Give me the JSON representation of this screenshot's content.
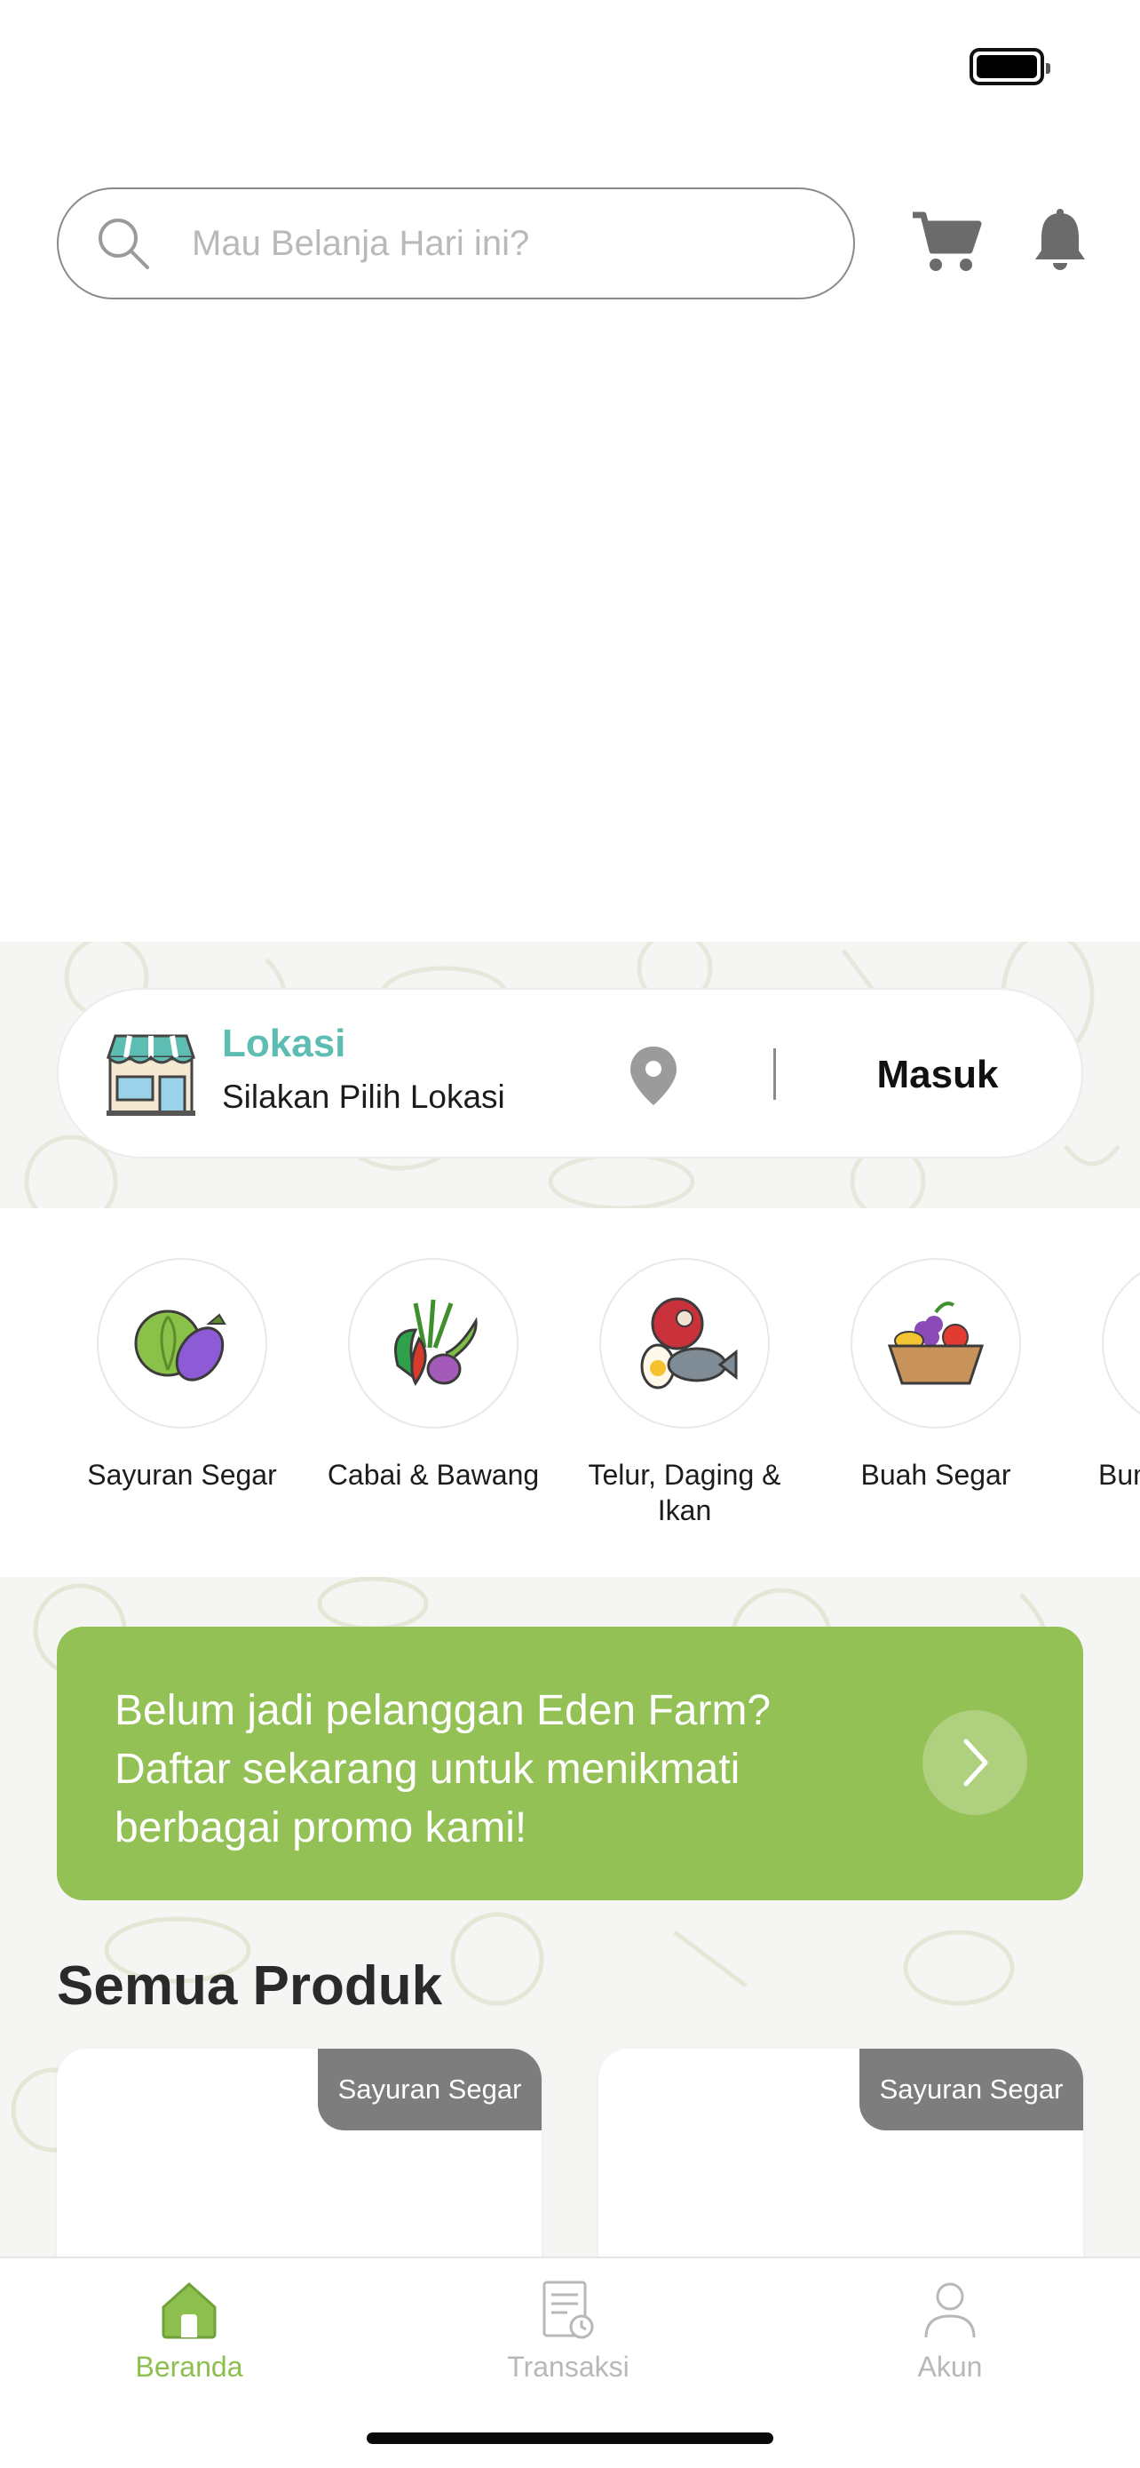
{
  "search": {
    "placeholder": "Mau Belanja Hari ini?"
  },
  "location": {
    "title": "Lokasi",
    "subtitle": "Silakan Pilih Lokasi",
    "login_label": "Masuk"
  },
  "categories": [
    {
      "label": "Sayuran Segar",
      "icon": "vegetables-icon"
    },
    {
      "label": "Cabai & Bawang",
      "icon": "chili-onion-icon"
    },
    {
      "label": "Telur, Daging & Ikan",
      "icon": "egg-meat-fish-icon"
    },
    {
      "label": "Buah Segar",
      "icon": "fruit-basket-icon"
    },
    {
      "label": "Bum",
      "icon": "partial-category-icon"
    }
  ],
  "promo": {
    "text": "Belum jadi pelanggan Eden Farm? Daftar sekarang untuk menikmati berbagai promo kami!"
  },
  "products_section": {
    "title": "Semua Produk"
  },
  "products": [
    {
      "tag": "Sayuran Segar"
    },
    {
      "tag": "Sayuran Segar"
    }
  ],
  "nav": {
    "home": "Beranda",
    "transactions": "Transaksi",
    "account": "Akun"
  },
  "colors": {
    "accent_green": "#93c155",
    "teal": "#5dbdb2",
    "tag_gray": "#7d7d7d",
    "nav_active": "#8cbf4e",
    "nav_inactive": "#b8b8b8"
  }
}
